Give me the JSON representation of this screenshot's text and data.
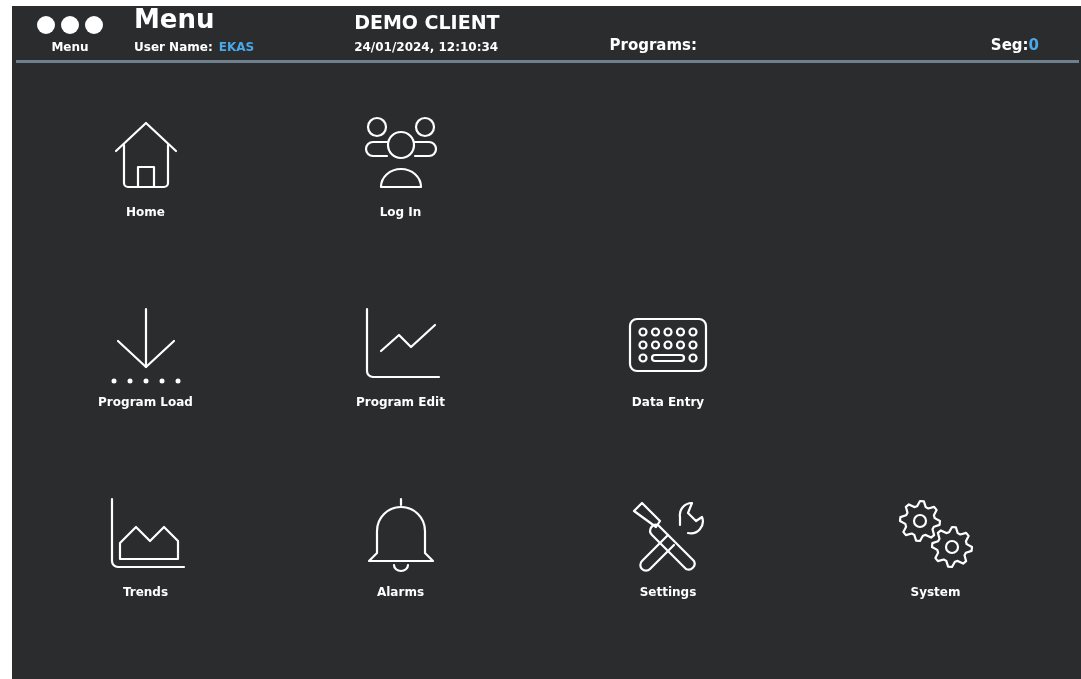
{
  "header": {
    "menu_label": "Menu",
    "title": "Menu",
    "user_label": "User Name:",
    "user_name": "EKAS",
    "client": "DEMO CLIENT",
    "datetime": "24/01/2024, 12:10:34",
    "programs_label": "Programs:",
    "seg_label": "Seg:",
    "seg_value": "0"
  },
  "tiles": [
    [
      {
        "kind": "home",
        "label": "Home"
      },
      {
        "kind": "users",
        "label": "Log In"
      }
    ],
    [
      {
        "kind": "download",
        "label": "Program Load"
      },
      {
        "kind": "line-chart",
        "label": "Program Edit"
      },
      {
        "kind": "keyboard",
        "label": "Data Entry"
      }
    ],
    [
      {
        "kind": "area-chart",
        "label": "Trends"
      },
      {
        "kind": "bell",
        "label": "Alarms"
      },
      {
        "kind": "tools",
        "label": "Settings"
      },
      {
        "kind": "gears",
        "label": "System"
      }
    ]
  ]
}
